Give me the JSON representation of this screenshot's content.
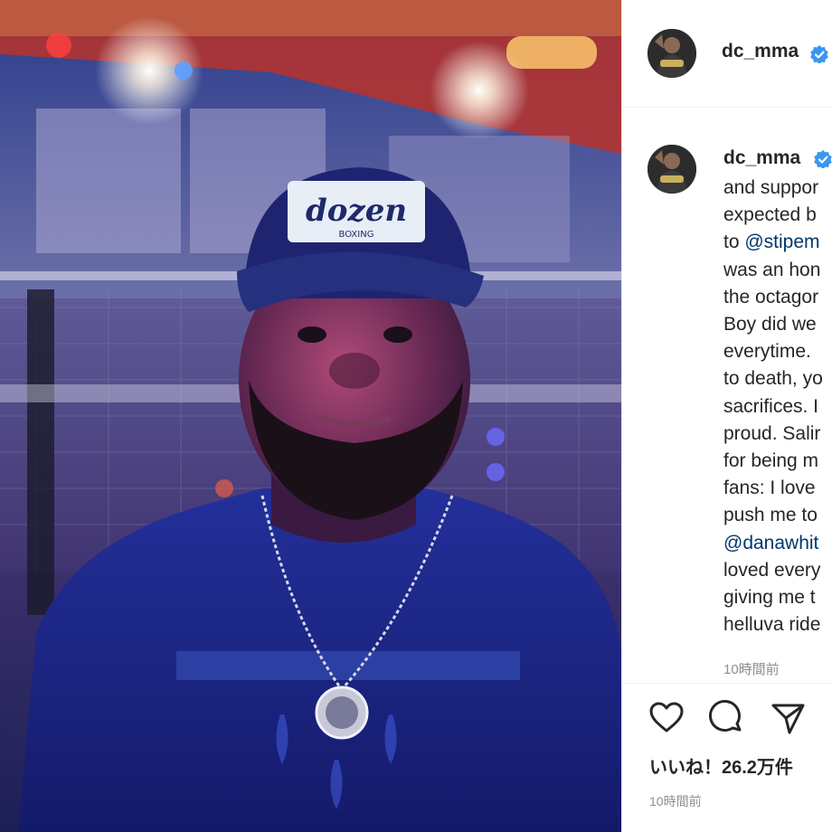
{
  "post": {
    "username": "dc_mma",
    "verified": true,
    "photo_description_icon": "photo",
    "cap_text": {
      "part1": "dozen",
      "part2": "BOXING"
    },
    "caption_lines": [
      {
        "text": "and suppor",
        "mention": false
      },
      {
        "text": "expected b",
        "mention": false
      },
      {
        "prefix": "to ",
        "text": "@stipem",
        "mention": true
      },
      {
        "text": "was an hon",
        "mention": false
      },
      {
        "text": "the octagor",
        "mention": false
      },
      {
        "text": "Boy did we",
        "mention": false
      },
      {
        "text": "everytime.",
        "mention": false
      },
      {
        "text": "to death, yo",
        "mention": false
      },
      {
        "text": "sacrifices. I",
        "mention": false
      },
      {
        "text": "proud. Salir",
        "mention": false
      },
      {
        "text": "for being m",
        "mention": false
      },
      {
        "text": "fans: I love",
        "mention": false
      },
      {
        "text": "push me to",
        "mention": false
      },
      {
        "prefix": "",
        "text": "@danawhit",
        "mention": true
      },
      {
        "text": "loved every",
        "mention": false
      },
      {
        "text": "giving me t",
        "mention": false
      },
      {
        "text": "helluva ride",
        "mention": false
      }
    ],
    "caption_time": "10時間前",
    "likes_text": "いいね！26.2万件",
    "post_time": "10時間前",
    "colors": {
      "verified_blue": "#3897f0",
      "mention": "#00376b",
      "muted": "#8e8e8e"
    }
  }
}
